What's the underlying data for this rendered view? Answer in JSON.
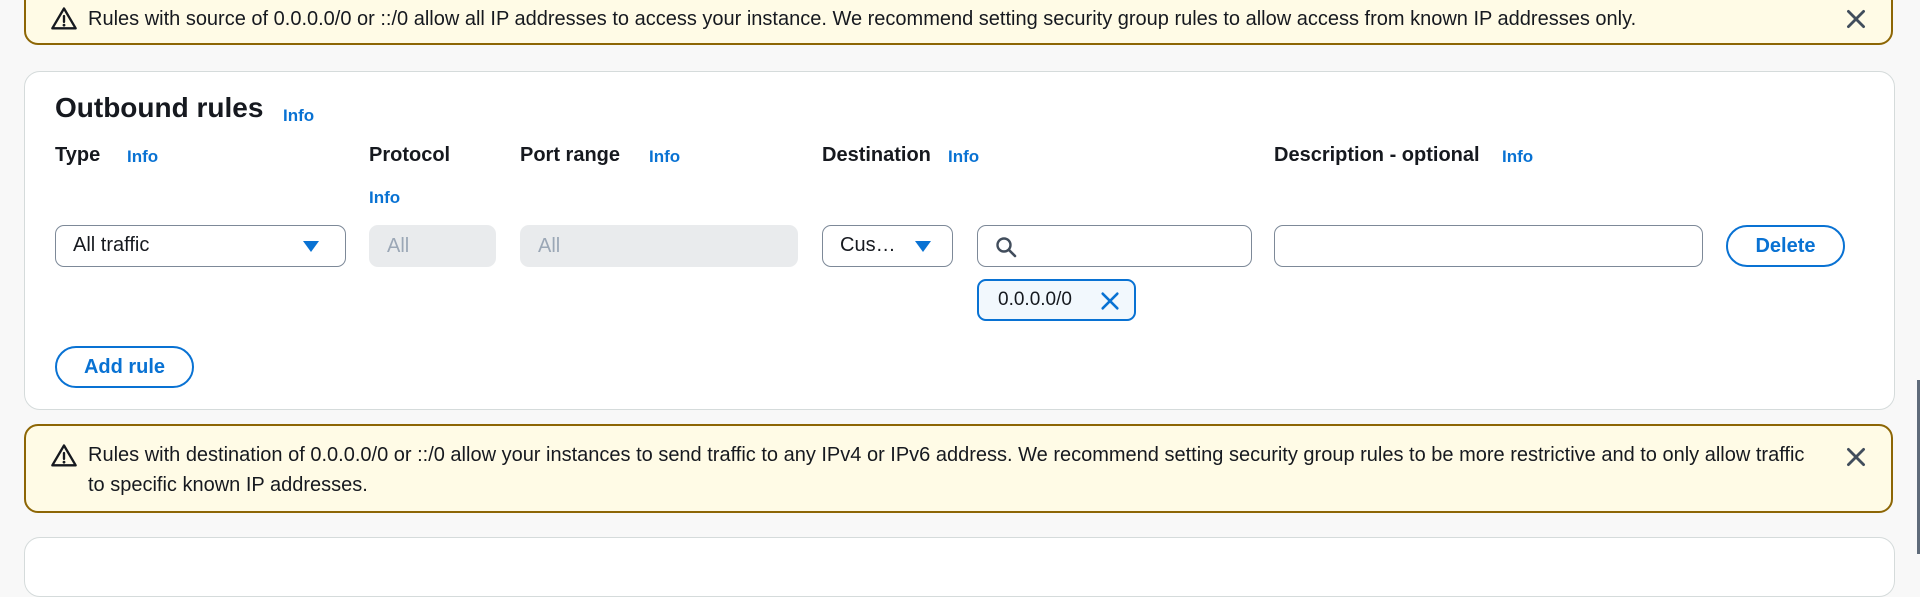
{
  "top_alert": {
    "text": "Rules with source of 0.0.0.0/0 or ::/0 allow all IP addresses to access your instance. We recommend setting security group rules to allow access from known IP addresses only."
  },
  "outbound": {
    "title": "Outbound rules",
    "title_info": "Info",
    "columns": {
      "type": {
        "label": "Type",
        "info": "Info"
      },
      "protocol": {
        "label": "Protocol",
        "info": "Info"
      },
      "port_range": {
        "label": "Port range",
        "info": "Info"
      },
      "destination": {
        "label": "Destination",
        "info": "Info"
      },
      "description": {
        "label": "Description - optional",
        "info": "Info"
      }
    },
    "rule": {
      "type_value": "All traffic",
      "protocol_value": "All",
      "port_range_value": "All",
      "destination_type": "Cus…",
      "destination_search": "",
      "destination_token": "0.0.0.0/0",
      "description_value": "",
      "delete_label": "Delete"
    },
    "add_rule_label": "Add rule"
  },
  "bottom_alert": {
    "text": "Rules with destination of 0.0.0.0/0 or ::/0 allow your instances to send traffic to any IPv4 or IPv6 address. We recommend setting security group rules to be more restrictive and to only allow traffic to specific known IP addresses."
  },
  "colors": {
    "accent": "#0972d3",
    "warning_border": "#8d6605",
    "warning_bg": "#fffbe6"
  }
}
